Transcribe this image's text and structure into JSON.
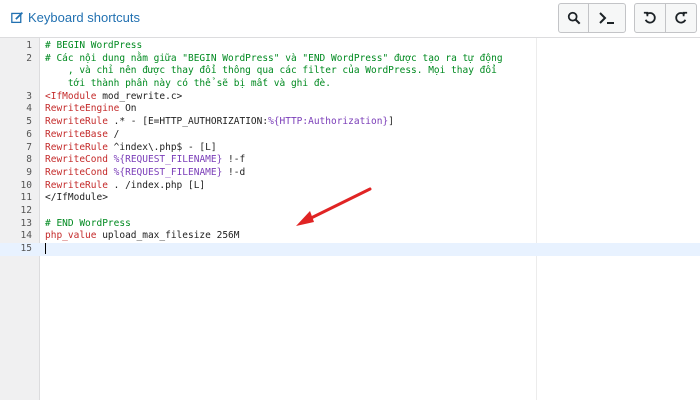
{
  "toolbar": {
    "shortcuts_label": "Keyboard shortcuts",
    "icons": [
      "edit-icon",
      "search-icon",
      "terminal-icon",
      "undo-icon",
      "redo-icon"
    ]
  },
  "editor": {
    "line_numbers": [
      "1",
      "2",
      "",
      "",
      "3",
      "4",
      "5",
      "6",
      "7",
      "8",
      "9",
      "10",
      "11",
      "12",
      "13",
      "14",
      "15"
    ],
    "lines": [
      {
        "cmt": "# BEGIN WordPress"
      },
      {
        "cmt": "# Các nội dung nằm giữa \"BEGIN WordPress\" và \"END WordPress\" được tạo ra tự động"
      },
      {
        "cmt": "    , và chỉ nên được thay đổi thông qua các filter của WordPress. Mọi thay đổi"
      },
      {
        "cmt": "    tới thành phần này có thể sẽ bị mất và ghi đè."
      },
      {
        "kw": "<IfModule",
        "rest": " mod_rewrite.c>"
      },
      {
        "kw": "RewriteEngine",
        "rest": " On"
      },
      {
        "kw": "RewriteRule",
        "rest": " .* - [E=HTTP_AUTHORIZATION:",
        "str": "%{HTTP:Authorization}",
        "rest2": "]"
      },
      {
        "kw": "RewriteBase",
        "rest": " /"
      },
      {
        "kw": "RewriteRule",
        "rest": " ^index\\.php$ - [L]"
      },
      {
        "kw": "RewriteCond",
        "rest": " ",
        "str": "%{REQUEST_FILENAME}",
        "rest2": " !-f"
      },
      {
        "kw": "RewriteCond",
        "rest": " ",
        "str": "%{REQUEST_FILENAME}",
        "rest2": " !-d"
      },
      {
        "kw": "RewriteRule",
        "rest": " . /index.php [L]"
      },
      {
        "rest": "</IfModule>"
      },
      {
        "rest": ""
      },
      {
        "cmt": "# END WordPress"
      },
      {
        "kw": "php_value",
        "rest": " upload_max_filesize 256M"
      },
      {
        "rest": ""
      }
    ]
  },
  "colors": {
    "link": "#2271b1",
    "comment": "#008a20",
    "keyword": "#c42a2a",
    "variable": "#7a3db8",
    "arrow": "#e02424"
  }
}
